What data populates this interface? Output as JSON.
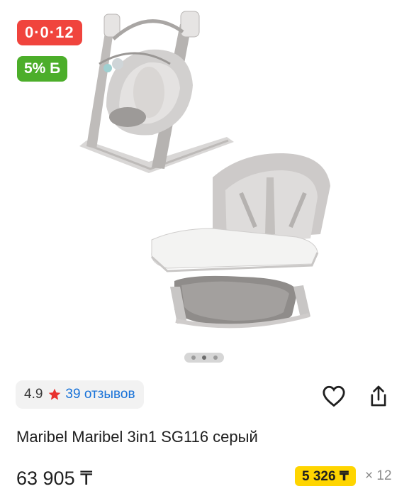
{
  "badges": {
    "installment": "0·0·12",
    "bonus": "5% Б"
  },
  "gallery": {
    "image_count": 3,
    "active_index": 1
  },
  "rating": {
    "value": "4.9",
    "reviews": "39 отзывов",
    "star_color": "#e8322f"
  },
  "actions": {
    "favorite_icon": "heart-icon",
    "share_icon": "share-icon"
  },
  "product": {
    "title": "Maribel Maribel 3in1 SG116 серый",
    "price": "63 905 ₸",
    "installment_amount": "5 326 ₸",
    "installment_months": "× 12"
  },
  "colors": {
    "installment_badge": "#f0443d",
    "bonus_badge": "#4cae2a",
    "installment_price_bg": "#ffd500",
    "link": "#1872d8"
  }
}
